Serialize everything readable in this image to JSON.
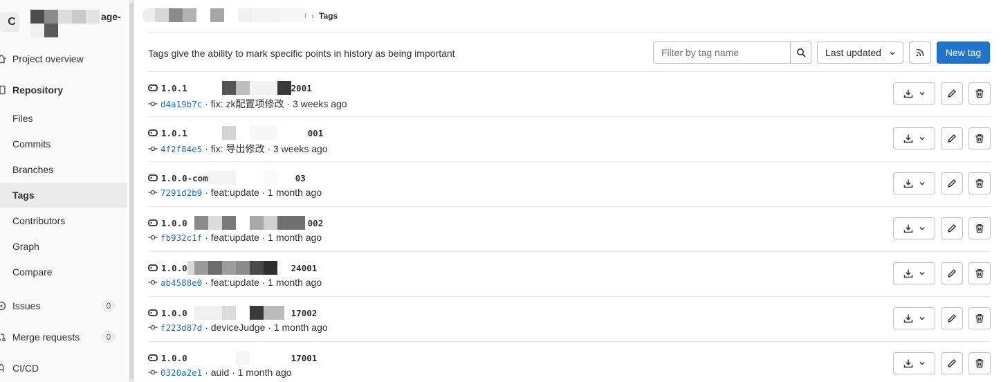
{
  "project": {
    "avatar_letter": "C",
    "name_suffix": "age-"
  },
  "nav": {
    "project_overview": "Project overview",
    "repository": "Repository",
    "files": "Files",
    "commits": "Commits",
    "branches": "Branches",
    "tags": "Tags",
    "contributors": "Contributors",
    "graph": "Graph",
    "compare": "Compare",
    "issues": "Issues",
    "issues_count": "0",
    "merge_requests": "Merge requests",
    "merge_requests_count": "0",
    "cicd": "CI/CD"
  },
  "breadcrumb": {
    "visible_fragment": "r",
    "separator": "›",
    "current": "Tags"
  },
  "toolbar": {
    "description": "Tags give the ability to mark specific points in history as being important",
    "filter_placeholder": "Filter by tag name",
    "sort_label": "Last updated",
    "new_tag_label": "New tag"
  },
  "tags": [
    {
      "name_start": "1.0.1",
      "name_end": "2001",
      "sha": "d4a19b7c",
      "message": "fix: zk配置项修改",
      "age": "3 weeks ago"
    },
    {
      "name_start": "1.0.1",
      "name_end": "001",
      "sha": "4f2f84e5",
      "message": "fix: 导出修改",
      "age": "3 weeks ago"
    },
    {
      "name_start": "1.0.0-com",
      "name_end": "03",
      "sha": "7291d2b9",
      "message": "feat:update",
      "age": "1 month ago"
    },
    {
      "name_start": "1.0.0",
      "name_end": "002",
      "sha": "fb932c1f",
      "message": "feat:update",
      "age": "1 month ago"
    },
    {
      "name_start": "1.0.0",
      "name_end": "24001",
      "sha": "ab4588e0",
      "message": "feat:update",
      "age": "1 month ago"
    },
    {
      "name_start": "1.0.0",
      "name_end": "17002",
      "sha": "f223d87d",
      "message": "deviceJudge",
      "age": "1 month ago"
    },
    {
      "name_start": "1.0.0",
      "name_end": "17001",
      "sha": "0320a2e1",
      "message": "auid",
      "age": "1 month ago"
    }
  ],
  "colors": {
    "primary": "#1f75cb",
    "link": "#1f6fbf",
    "active_nav_bg": "#ebebeb"
  }
}
